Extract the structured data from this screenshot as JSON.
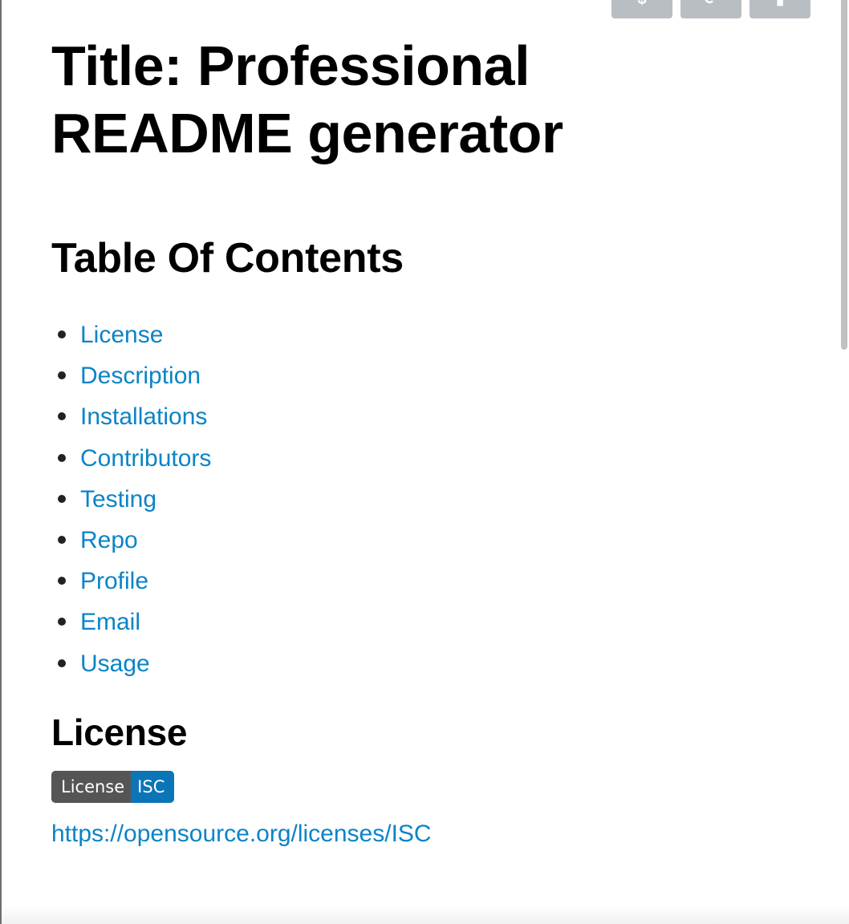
{
  "top_buttons": [
    {
      "glyph": "$"
    },
    {
      "glyph": "⟳"
    },
    {
      "glyph": "▮"
    }
  ],
  "title": "Title: Professional README generator",
  "toc": {
    "heading": "Table Of Contents",
    "items": [
      {
        "label": "License"
      },
      {
        "label": "Description"
      },
      {
        "label": "Installations"
      },
      {
        "label": "Contributors"
      },
      {
        "label": "Testing"
      },
      {
        "label": "Repo"
      },
      {
        "label": "Profile"
      },
      {
        "label": "Email"
      },
      {
        "label": "Usage"
      }
    ]
  },
  "license": {
    "heading": "License",
    "badge_left": "License",
    "badge_right": "ISC",
    "url": "https://opensource.org/licenses/ISC"
  },
  "colors": {
    "link": "#0b84c6",
    "badge_left": "#555555",
    "badge_right": "#0b75b8",
    "toolbar_button": "#b9bec3"
  }
}
